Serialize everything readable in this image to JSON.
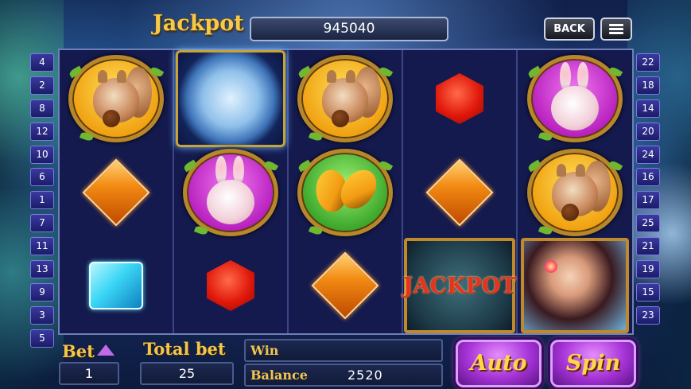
{
  "header": {
    "jackpot_label": "Jackpot",
    "jackpot_value": "945040",
    "back_label": "BACK",
    "menu_icon": "menu-icon"
  },
  "paylines": {
    "left": [
      "4",
      "2",
      "8",
      "12",
      "10",
      "6",
      "1",
      "7",
      "11",
      "13",
      "9",
      "3",
      "5"
    ],
    "right": [
      "22",
      "18",
      "14",
      "20",
      "24",
      "16",
      "17",
      "25",
      "21",
      "19",
      "15",
      "23"
    ]
  },
  "reels": {
    "rows": [
      [
        "squirrel",
        "moon",
        "squirrel",
        "red-gem",
        "rabbit"
      ],
      [
        "orange-gem",
        "rabbit",
        "butterfly",
        "orange-gem",
        "squirrel"
      ],
      [
        "blue-gem",
        "red-gem",
        "orange-gem",
        "jackpot",
        "fairy"
      ]
    ],
    "jackpot_symbol_text": "JACKPOT"
  },
  "controls": {
    "bet_label": "Bet",
    "bet_value": "1",
    "total_bet_label": "Total bet",
    "total_bet_value": "25",
    "win_label": "Win",
    "win_value": "",
    "balance_label": "Balance",
    "balance_value": "2520",
    "auto_label": "Auto",
    "spin_label": "Spin"
  },
  "colors": {
    "gold_text": "#f4c64a",
    "button_purple": "#a633d6",
    "reel_bg": "#141a4e"
  }
}
